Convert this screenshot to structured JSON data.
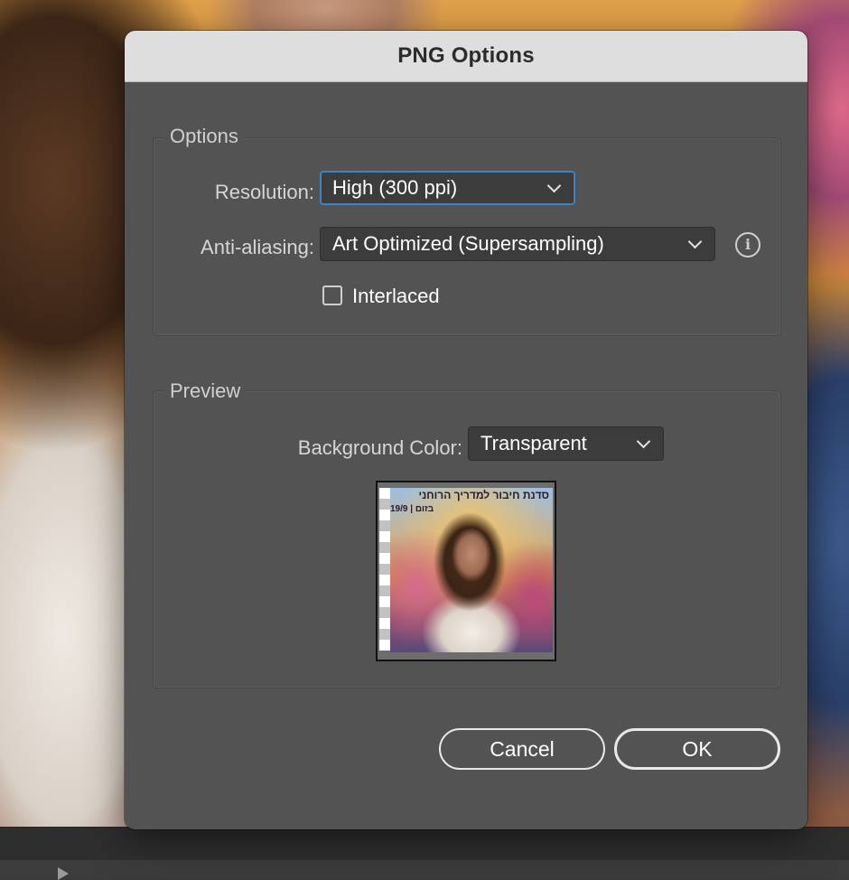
{
  "dialog": {
    "title": "PNG Options",
    "options_group": {
      "legend": "Options",
      "resolution": {
        "label": "Resolution:",
        "value": "High (300 ppi)"
      },
      "anti_aliasing": {
        "label": "Anti-aliasing:",
        "value": "Art Optimized (Supersampling)"
      },
      "interlaced": {
        "label": "Interlaced",
        "checked": false
      }
    },
    "preview_group": {
      "legend": "Preview",
      "background_color": {
        "label": "Background Color:",
        "value": "Transparent"
      },
      "thumbnail": {
        "title_text": "סדנת חיבור למדריך הרוחני",
        "date_text": "19/9 | בזום"
      }
    },
    "buttons": {
      "cancel": "Cancel",
      "ok": "OK"
    }
  },
  "icons": {
    "info": "info-icon",
    "chevron": "chevron-down-icon",
    "play": "play-icon"
  },
  "colors": {
    "dialog_bg": "#535353",
    "titlebar_bg": "#dedede",
    "focus_ring": "#3e82c8",
    "select_bg": "#3c3c3c"
  }
}
